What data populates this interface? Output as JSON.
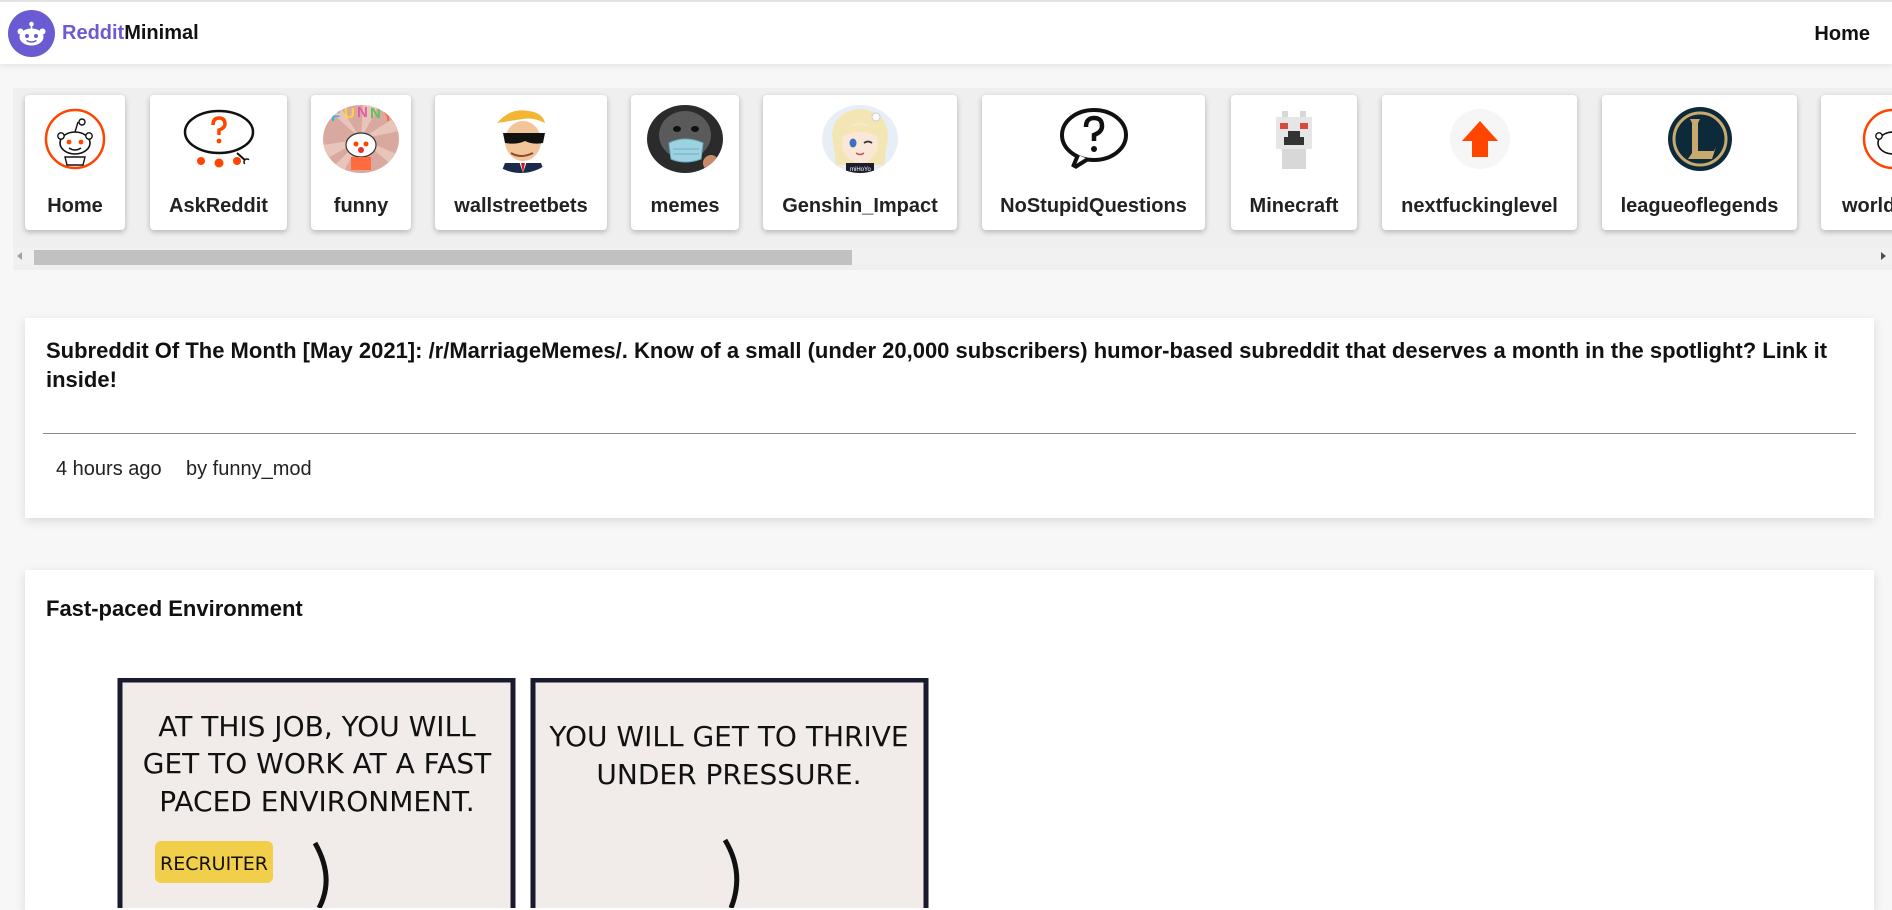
{
  "header": {
    "brand_part1": "Reddit",
    "brand_part2": "Minimal",
    "nav_home": "Home",
    "accent": "#6b5bd2"
  },
  "subreddits": [
    {
      "label": "Home",
      "icon": "reddit-alien-icon"
    },
    {
      "label": "AskReddit",
      "icon": "askreddit-icon"
    },
    {
      "label": "funny",
      "icon": "funny-icon"
    },
    {
      "label": "wallstreetbets",
      "icon": "wallstreetbets-icon"
    },
    {
      "label": "memes",
      "icon": "memes-icon"
    },
    {
      "label": "Genshin_Impact",
      "icon": "genshin-icon"
    },
    {
      "label": "NoStupidQuestions",
      "icon": "speech-bubble-question-icon"
    },
    {
      "label": "Minecraft",
      "icon": "minecraft-icon"
    },
    {
      "label": "nextfuckinglevel",
      "icon": "up-arrow-icon"
    },
    {
      "label": "leagueoflegends",
      "icon": "league-logo-icon"
    },
    {
      "label": "worldnews",
      "icon": "reddit-alien-icon"
    }
  ],
  "posts": [
    {
      "title": "Subreddit Of The Month [May 2021]: /r/MarriageMemes/. Know of a small (under 20,000 subscribers) humor-based subreddit that deserves a month in the spotlight? Link it inside!",
      "time": "4 hours ago",
      "author": "by funny_mod"
    },
    {
      "title": "Fast-paced Environment",
      "comic": {
        "panel1_text": [
          "AT THIS JOB, YOU WILL",
          "GET TO WORK AT A FAST",
          "PACED ENVIRONMENT."
        ],
        "panel1_tag": "RECRUITER",
        "panel2_text": [
          "YOU WILL GET TO THRIVE",
          "UNDER PRESSURE."
        ]
      }
    }
  ]
}
